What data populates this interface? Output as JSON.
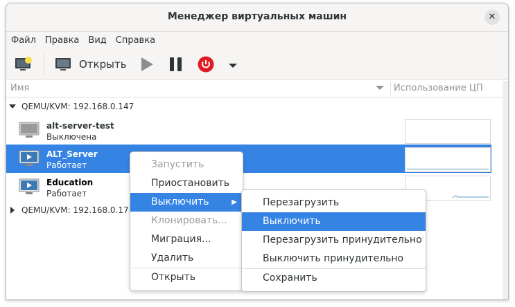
{
  "window": {
    "title": "Менеджер виртуальных машин"
  },
  "menubar": [
    "Файл",
    "Правка",
    "Вид",
    "Справка"
  ],
  "toolbar": {
    "open_label": "Открыть"
  },
  "columns": {
    "name": "Имя",
    "cpu": "Использование ЦП"
  },
  "hosts": [
    {
      "label": "QEMU/KVM: 192.168.0.147",
      "expanded": true,
      "vms": [
        {
          "name": "alt-server-test",
          "status": "Выключена"
        },
        {
          "name": "ALT_Server",
          "status": "Работает"
        },
        {
          "name": "Education",
          "status": "Работает"
        }
      ]
    },
    {
      "label": "QEMU/KVM: 192.168.0.175",
      "expanded": false
    }
  ],
  "context_menu": [
    "Запустить",
    "Приостановить",
    "Выключить",
    "Клонировать...",
    "Миграция...",
    "Удалить",
    "Открыть"
  ],
  "submenu": [
    "Перезагрузить",
    "Выключить",
    "Перезагрузить принудительно",
    "Выключить принудительно",
    "Сохранить"
  ],
  "colors": {
    "accent": "#3584e4",
    "power": "#e01b24"
  }
}
